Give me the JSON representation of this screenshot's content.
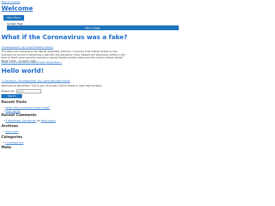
{
  "skip_link": "Skip to content",
  "site_title": "Welcome",
  "main_menu_label": "Main Menu",
  "sample_page": "Sample Page",
  "menu_toggle": "Menu Toggle",
  "posts": [
    {
      "title": "What if the Coronavirus was a fake?",
      "meta": "Uncategorized / By Lionel Blondeel Family",
      "excerpt": "The steps are changing in the World, especially America. A country that relates strictly on the economy to survive is becoming a low with the pandemic crisis. Beware are becoming united in this time of need, when poverty reaches a normal threat survival mode and this country stand united? While Covid - 19 takes upon…",
      "more": "What if the Coronavirus was a fake? Read More »"
    },
    {
      "title": "Hello world!",
      "meta": "1 Comment / Uncategorized / By Lionel Blondeel Family",
      "body": "Welcome to WordPress. This is your first post. Edit or delete it, then start writing!"
    }
  ],
  "search": {
    "label": "Search for:",
    "placeholder": "Search …",
    "button": "Search"
  },
  "widgets": {
    "recent_posts": {
      "title": "Recent Posts",
      "items": [
        "What if the Coronavirus was a fake?",
        "Hello world!"
      ]
    },
    "recent_comments": {
      "title": "Recent Comments",
      "author": "A WordPress Commenter",
      "on": "on",
      "post": "Hello world!"
    },
    "archives": {
      "title": "Archives",
      "items": [
        "April 2020"
      ]
    },
    "categories": {
      "title": "Categories",
      "items": [
        "Uncategorized"
      ]
    },
    "meta": {
      "title": "Meta"
    }
  }
}
